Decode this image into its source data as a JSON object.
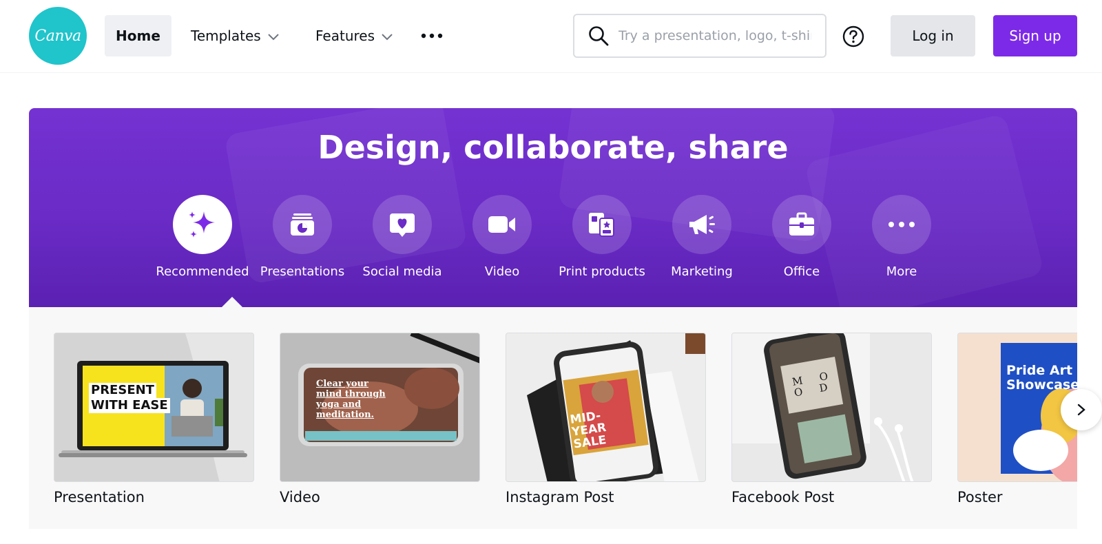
{
  "header": {
    "logo_text": "Canva",
    "nav": {
      "home": "Home",
      "templates": "Templates",
      "features": "Features"
    },
    "search_placeholder": "Try a presentation, logo, t-shirt",
    "login_label": "Log in",
    "signup_label": "Sign up",
    "more_icon": "ellipsis-icon",
    "help_icon": "help-circle-icon"
  },
  "hero": {
    "title": "Design, collaborate, share",
    "categories": [
      {
        "label": "Recommended",
        "icon": "sparkle-icon",
        "active": true
      },
      {
        "label": "Presentations",
        "icon": "presentation-icon"
      },
      {
        "label": "Social media",
        "icon": "heart-chat-icon"
      },
      {
        "label": "Video",
        "icon": "video-camera-icon"
      },
      {
        "label": "Print products",
        "icon": "print-products-icon"
      },
      {
        "label": "Marketing",
        "icon": "megaphone-icon"
      },
      {
        "label": "Office",
        "icon": "briefcase-icon"
      },
      {
        "label": "More",
        "icon": "ellipsis-icon"
      }
    ]
  },
  "cards": [
    {
      "label": "Presentation",
      "thumb_text_1": "PRESENT",
      "thumb_text_2": "WITH EASE"
    },
    {
      "label": "Video",
      "thumb_text": "Clear your mind through yoga and meditation."
    },
    {
      "label": "Instagram Post",
      "thumb_text": "MID-YEAR SALE"
    },
    {
      "label": "Facebook Post",
      "thumb_text": "M O O D"
    },
    {
      "label": "Poster",
      "thumb_text": "Pride Art Showcase"
    }
  ],
  "colors": {
    "brand_teal": "#20c4cb",
    "brand_purple": "#7d2ae8",
    "hero_purple": "#6a2bc6"
  }
}
